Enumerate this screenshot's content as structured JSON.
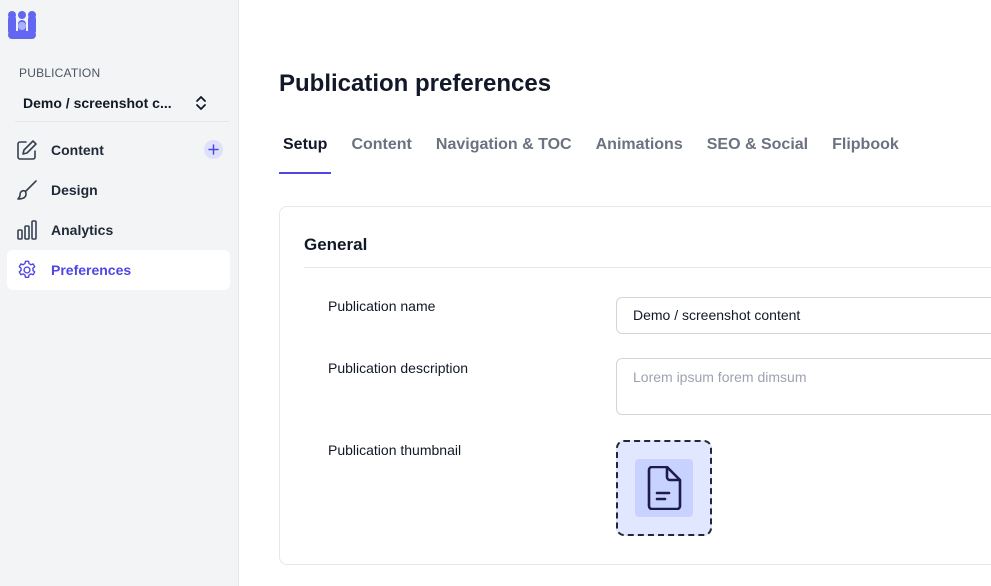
{
  "sidebar": {
    "section_label": "PUBLICATION",
    "publication_name": "Demo / screenshot c...",
    "items": [
      {
        "label": "Content",
        "icon": "pencil-square-icon"
      },
      {
        "label": "Design",
        "icon": "paintbrush-icon"
      },
      {
        "label": "Analytics",
        "icon": "bar-chart-icon"
      },
      {
        "label": "Preferences",
        "icon": "gear-icon"
      }
    ],
    "active_item": "Preferences"
  },
  "page": {
    "title": "Publication preferences",
    "tabs": [
      "Setup",
      "Content",
      "Navigation & TOC",
      "Animations",
      "SEO & Social",
      "Flipbook"
    ],
    "active_tab": "Setup"
  },
  "general": {
    "title": "General",
    "name_label": "Publication name",
    "name_value": "Demo / screenshot content",
    "description_label": "Publication description",
    "description_placeholder": "Lorem ipsum forem dimsum",
    "thumbnail_label": "Publication thumbnail"
  },
  "colors": {
    "accent": "#4f46e5",
    "sidebar_bg": "#f3f4f6",
    "thumbnail_bg": "#e0e7ff"
  }
}
